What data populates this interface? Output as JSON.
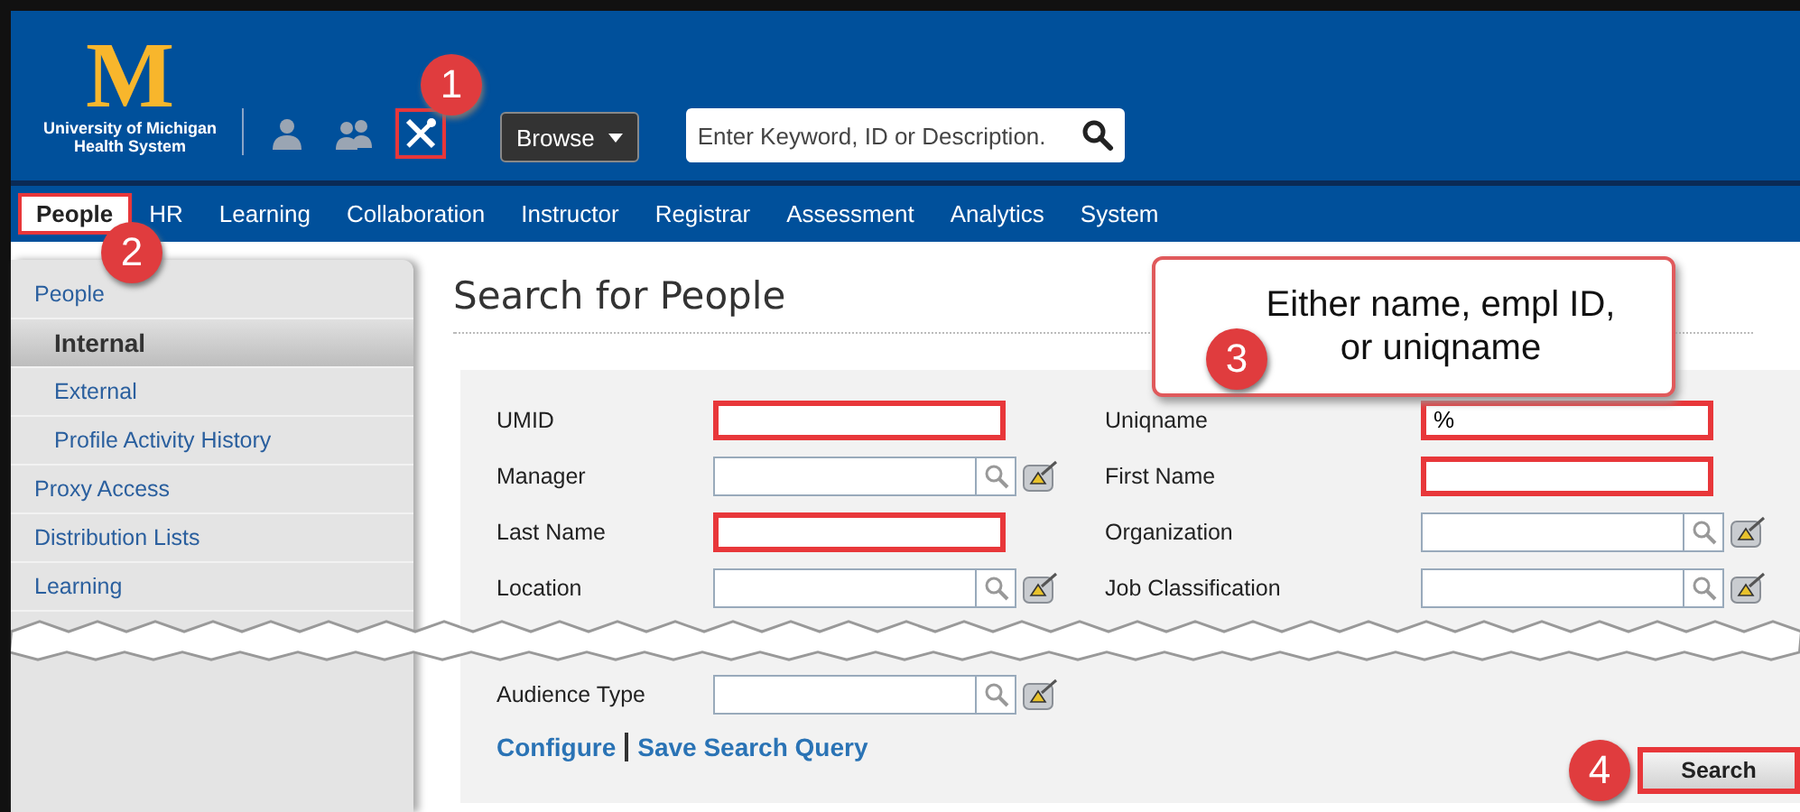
{
  "header": {
    "logo_letter": "M",
    "logo_text": "University of Michigan Health System",
    "icons": [
      {
        "kind": "person",
        "highlighted": false
      },
      {
        "kind": "people",
        "highlighted": false
      },
      {
        "kind": "tools",
        "highlighted": true,
        "marker": "1"
      }
    ],
    "browse": "Browse",
    "search": {
      "placeholder": "Enter Keyword, ID or Description."
    }
  },
  "nav": [
    {
      "label": "People",
      "selected": true,
      "highlighted": true,
      "marker": "2"
    },
    {
      "label": "HR",
      "selected": false,
      "highlighted": false
    },
    {
      "label": "Learning",
      "selected": false,
      "highlighted": false
    },
    {
      "label": "Collaboration",
      "selected": false,
      "highlighted": false
    },
    {
      "label": "Instructor",
      "selected": false,
      "highlighted": false
    },
    {
      "label": "Registrar",
      "selected": false,
      "highlighted": false
    },
    {
      "label": "Assessment",
      "selected": false,
      "highlighted": false
    },
    {
      "label": "Analytics",
      "selected": false,
      "highlighted": false
    },
    {
      "label": "System",
      "selected": false,
      "highlighted": false
    }
  ],
  "sidebar": {
    "items": [
      {
        "label": "People",
        "selected": false,
        "children": [
          {
            "label": "Internal",
            "selected": true
          },
          {
            "label": "External",
            "selected": false
          },
          {
            "label": "Profile Activity History",
            "selected": false
          }
        ]
      },
      {
        "label": "Proxy Access",
        "selected": false
      },
      {
        "label": "Distribution Lists",
        "selected": false
      },
      {
        "label": "Learning",
        "selected": false
      }
    ]
  },
  "title": "Search for People",
  "form": {
    "rows": [
      [
        {
          "label": "UMID",
          "kind": "plain",
          "highlighted": true
        },
        {
          "label": "Uniqname",
          "kind": "plain",
          "highlighted": true,
          "value": "%"
        }
      ],
      [
        {
          "label": "Manager",
          "kind": "lookup",
          "highlighted": false
        },
        {
          "label": "First Name",
          "kind": "plain",
          "highlighted": true
        }
      ],
      [
        {
          "label": "Last Name",
          "kind": "plain",
          "highlighted": true
        },
        {
          "label": "Organization",
          "kind": "lookup",
          "highlighted": false
        }
      ],
      [
        {
          "label": "Location",
          "kind": "lookup",
          "highlighted": false
        },
        {
          "label": "Job Classification",
          "kind": "lookup",
          "highlighted": false
        }
      ],
      [
        {
          "label": "Audience Type",
          "kind": "lookup",
          "highlighted": false
        }
      ]
    ],
    "links": [
      "Configure",
      "Save Search Query"
    ],
    "search_button": {
      "label": "Search",
      "highlighted": true,
      "marker": "4"
    }
  },
  "callout": {
    "text": "Either name, empl ID, or uniqname",
    "marker": "3"
  }
}
